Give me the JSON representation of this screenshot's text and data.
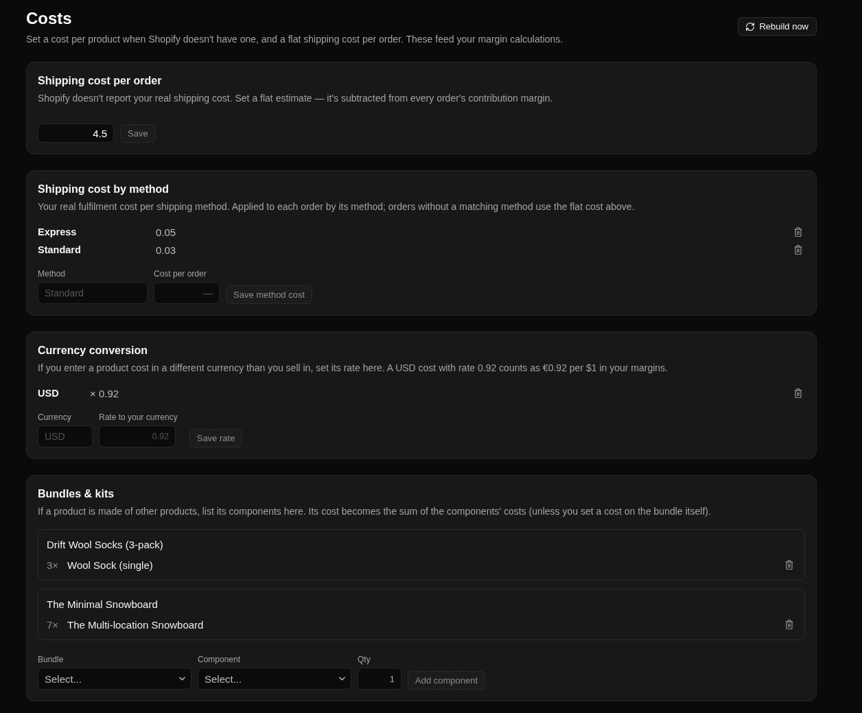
{
  "header": {
    "title": "Costs",
    "subtitle": "Set a cost per product when Shopify doesn't have one, and a flat shipping cost per order. These feed your margin calculations.",
    "rebuild_button": {
      "label": "Rebuild now",
      "disabled": false
    }
  },
  "shipping_cost_per_order": {
    "title": "Shipping cost per order",
    "description": "Shopify doesn't report your real shipping cost. Set a flat estimate — it's subtracted from every order's contribution margin.",
    "value": "4.5",
    "save_button": {
      "label": "Save",
      "disabled": true
    }
  },
  "shipping_cost_by_method": {
    "title": "Shipping cost by method",
    "description": "Your real fulfilment cost per shipping method. Applied to each order by its method; orders without a matching method use the flat cost above.",
    "methods": [
      {
        "name": "Express",
        "cost": "0.05"
      },
      {
        "name": "Standard",
        "cost": "0.03"
      }
    ],
    "form": {
      "method_label": "Method",
      "method_placeholder": "Standard",
      "cost_label": "Cost per order",
      "cost_placeholder": "—",
      "save_button": {
        "label": "Save method cost",
        "disabled": true
      }
    }
  },
  "currency_conversion": {
    "title": "Currency conversion",
    "description": "If you enter a product cost in a different currency than you sell in, set its rate here. A USD cost with rate 0.92 counts as €0.92 per $1 in your margins.",
    "rates": [
      {
        "currency": "USD",
        "rate": "× 0.92"
      }
    ],
    "form": {
      "currency_label": "Currency",
      "currency_placeholder": "USD",
      "rate_label": "Rate to your currency",
      "rate_placeholder": "0.92",
      "save_button": {
        "label": "Save rate",
        "disabled": true
      }
    }
  },
  "bundles_and_kits": {
    "title": "Bundles & kits",
    "description": "If a product is made of other products, list its components here. Its cost becomes the sum of the components' costs (unless you set a cost on the bundle itself).",
    "bundles": [
      {
        "name": "Drift Wool Socks (3-pack)",
        "components": [
          {
            "qty": "3×",
            "name": "Wool Sock (single)"
          }
        ]
      },
      {
        "name": "The Minimal Snowboard",
        "components": [
          {
            "qty": "7×",
            "name": "The Multi-location Snowboard"
          }
        ]
      }
    ],
    "form": {
      "bundle_label": "Bundle",
      "bundle_value": "Select...",
      "component_label": "Component",
      "component_value": "Select...",
      "qty_label": "Qty",
      "qty_value": "1",
      "add_button": {
        "label": "Add component",
        "disabled": true
      }
    }
  }
}
